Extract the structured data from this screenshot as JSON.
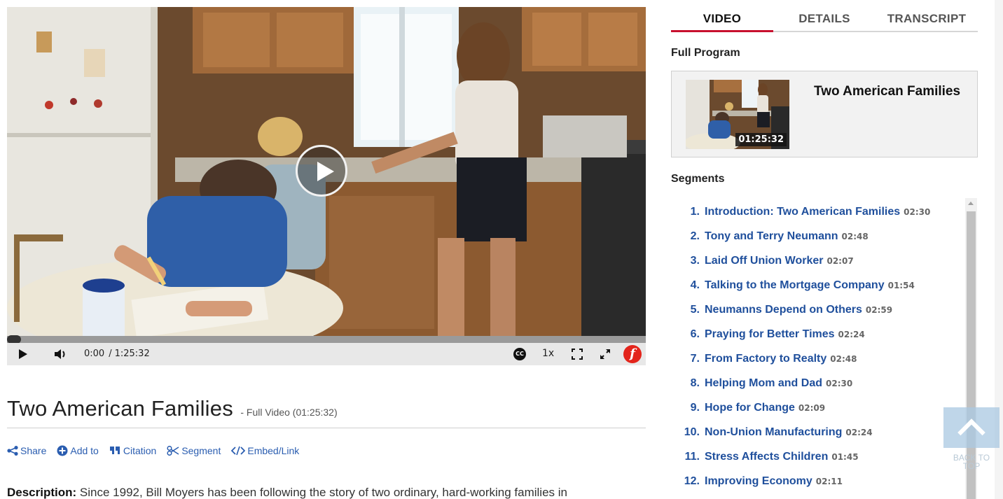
{
  "player": {
    "current_time": "0:00",
    "separator": "/",
    "duration": "1:25:32",
    "cc_label": "CC",
    "playback_rate": "1x",
    "logo_letter": "f",
    "progress": 0.0
  },
  "video": {
    "title": "Two American Families",
    "subtitle": "- Full Video (01:25:32)"
  },
  "actions": [
    {
      "label": "Share",
      "icon": "share-icon"
    },
    {
      "label": "Add to",
      "icon": "plus-circle-icon"
    },
    {
      "label": "Citation",
      "icon": "quote-icon"
    },
    {
      "label": "Segment",
      "icon": "scissors-icon"
    },
    {
      "label": "Embed/Link",
      "icon": "code-icon"
    }
  ],
  "description": {
    "label": "Description:",
    "text": "Since 1992, Bill Moyers has been following the story of two ordinary, hard-working families in"
  },
  "tabs": [
    {
      "label": "VIDEO",
      "active": true
    },
    {
      "label": "DETAILS",
      "active": false
    },
    {
      "label": "TRANSCRIPT",
      "active": false
    }
  ],
  "full_program": {
    "heading": "Full Program",
    "title": "Two American Families",
    "duration": "01:25:32"
  },
  "segments": {
    "heading": "Segments",
    "items": [
      {
        "num": "1.",
        "name": "Introduction: Two American Families",
        "dur": "02:30"
      },
      {
        "num": "2.",
        "name": "Tony and Terry Neumann",
        "dur": "02:48"
      },
      {
        "num": "3.",
        "name": "Laid Off Union Worker",
        "dur": "02:07"
      },
      {
        "num": "4.",
        "name": "Talking to the Mortgage Company",
        "dur": "01:54"
      },
      {
        "num": "5.",
        "name": "Neumanns Depend on Others",
        "dur": "02:59"
      },
      {
        "num": "6.",
        "name": "Praying for Better Times",
        "dur": "02:24"
      },
      {
        "num": "7.",
        "name": "From Factory to Realty",
        "dur": "02:48"
      },
      {
        "num": "8.",
        "name": "Helping Mom and Dad",
        "dur": "02:30"
      },
      {
        "num": "9.",
        "name": "Hope for Change",
        "dur": "02:09"
      },
      {
        "num": "10.",
        "name": "Non-Union Manufacturing",
        "dur": "02:24"
      },
      {
        "num": "11.",
        "name": "Stress Affects Children",
        "dur": "01:45"
      },
      {
        "num": "12.",
        "name": "Improving Economy",
        "dur": "02:11"
      }
    ]
  },
  "back_to_top": {
    "label": "BACK TO TOP"
  },
  "colors": {
    "accent_red": "#c8102e",
    "link_blue": "#1f4f9c",
    "logo_red": "#e3241b"
  }
}
